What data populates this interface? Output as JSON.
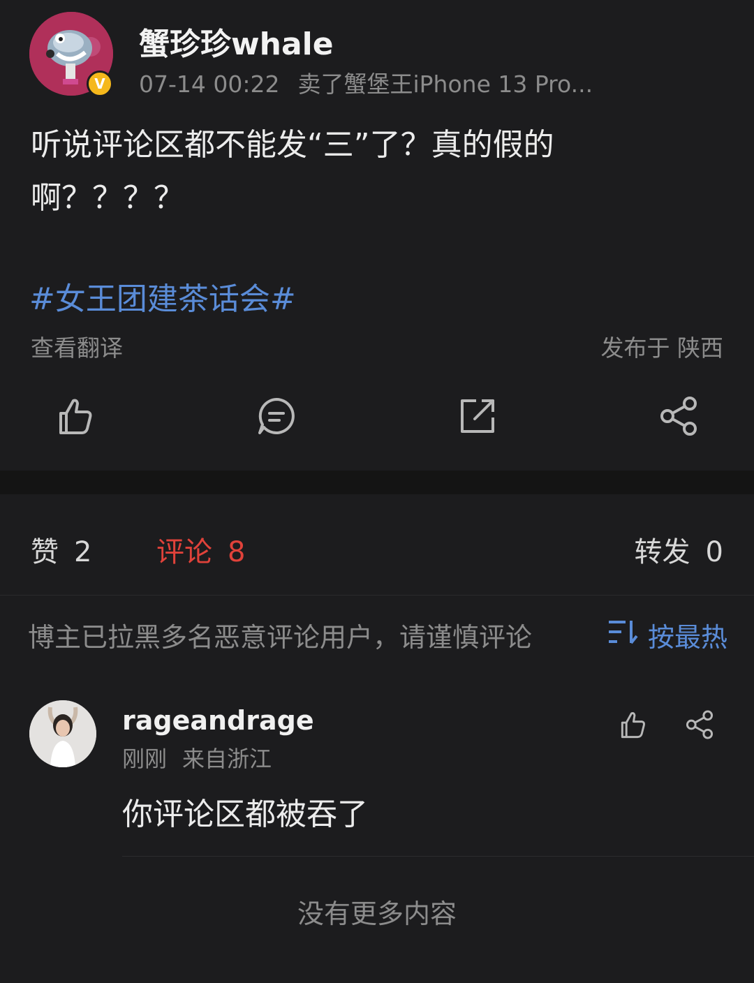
{
  "post": {
    "author_name": "蟹珍珍whale",
    "verified_mark": "V",
    "timestamp": "07-14 00:22",
    "device": "卖了蟹堡王iPhone 13 Pro...",
    "text": "听说评论区都不能发“三”了？真的假的啊？？？？",
    "hashtag": "#女王团建茶话会#",
    "translate_label": "查看翻译",
    "location": "发布于 陕西",
    "actions": [
      "like-icon",
      "comment-icon",
      "repost-icon",
      "share-icon"
    ]
  },
  "stats": {
    "likes_label": "赞",
    "likes_count": "2",
    "comments_label": "评论",
    "comments_count": "8",
    "reposts_label": "转发",
    "reposts_count": "0",
    "active_color": "#e0423a"
  },
  "comments_section": {
    "notice": "博主已拉黑多名恶意评论用户，请谨慎评论",
    "sort_label": "按最热",
    "accent_color": "#5a8cd8",
    "items": [
      {
        "user": "rageandrage",
        "time": "刚刚",
        "from": "来自浙江",
        "text": "你评论区都被吞了"
      }
    ],
    "end_text": "没有更多内容"
  }
}
